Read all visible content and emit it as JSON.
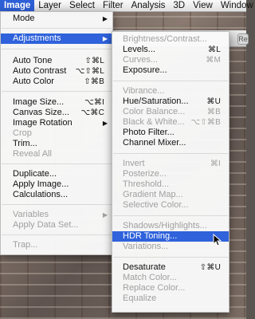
{
  "menubar": {
    "items": [
      {
        "label": "Image",
        "active": true
      },
      {
        "label": "Layer"
      },
      {
        "label": "Select"
      },
      {
        "label": "Filter"
      },
      {
        "label": "Analysis"
      },
      {
        "label": "3D"
      },
      {
        "label": "View"
      },
      {
        "label": "Window"
      }
    ]
  },
  "image_menu": {
    "mode": {
      "label": "Mode"
    },
    "adjustments": {
      "label": "Adjustments"
    },
    "auto_tone": {
      "label": "Auto Tone",
      "shortcut": "⇧⌘L"
    },
    "auto_contrast": {
      "label": "Auto Contrast",
      "shortcut": "⌥⇧⌘L"
    },
    "auto_color": {
      "label": "Auto Color",
      "shortcut": "⇧⌘B"
    },
    "image_size": {
      "label": "Image Size...",
      "shortcut": "⌥⌘I"
    },
    "canvas_size": {
      "label": "Canvas Size...",
      "shortcut": "⌥⌘C"
    },
    "image_rotation": {
      "label": "Image Rotation"
    },
    "crop": {
      "label": "Crop"
    },
    "trim": {
      "label": "Trim..."
    },
    "reveal_all": {
      "label": "Reveal All"
    },
    "duplicate": {
      "label": "Duplicate..."
    },
    "apply_image": {
      "label": "Apply Image..."
    },
    "calculations": {
      "label": "Calculations..."
    },
    "variables": {
      "label": "Variables"
    },
    "apply_data_set": {
      "label": "Apply Data Set..."
    },
    "trap": {
      "label": "Trap..."
    }
  },
  "adjustments_menu": {
    "brightness_contrast": {
      "label": "Brightness/Contrast..."
    },
    "levels": {
      "label": "Levels...",
      "shortcut": "⌘L"
    },
    "curves": {
      "label": "Curves...",
      "shortcut": "⌘M"
    },
    "exposure": {
      "label": "Exposure..."
    },
    "vibrance": {
      "label": "Vibrance..."
    },
    "hue_saturation": {
      "label": "Hue/Saturation...",
      "shortcut": "⌘U"
    },
    "color_balance": {
      "label": "Color Balance...",
      "shortcut": "⌘B"
    },
    "black_white": {
      "label": "Black & White...",
      "shortcut": "⌥⇧⌘B"
    },
    "photo_filter": {
      "label": "Photo Filter..."
    },
    "channel_mixer": {
      "label": "Channel Mixer..."
    },
    "invert": {
      "label": "Invert",
      "shortcut": "⌘I"
    },
    "posterize": {
      "label": "Posterize..."
    },
    "threshold": {
      "label": "Threshold..."
    },
    "gradient_map": {
      "label": "Gradient Map..."
    },
    "selective_color": {
      "label": "Selective Color..."
    },
    "shadows_highlights": {
      "label": "Shadows/Highlights..."
    },
    "hdr_toning": {
      "label": "HDR Toning..."
    },
    "variations": {
      "label": "Variations..."
    },
    "desaturate": {
      "label": "Desaturate",
      "shortcut": "⇧⌘U"
    },
    "match_color": {
      "label": "Match Color..."
    },
    "replace_color": {
      "label": "Replace Color..."
    },
    "equalize": {
      "label": "Equalize"
    }
  },
  "window_controls": {
    "reset_label": "Re"
  },
  "colors": {
    "highlight": "#2f62db",
    "disabled": "#a0a0a0"
  }
}
